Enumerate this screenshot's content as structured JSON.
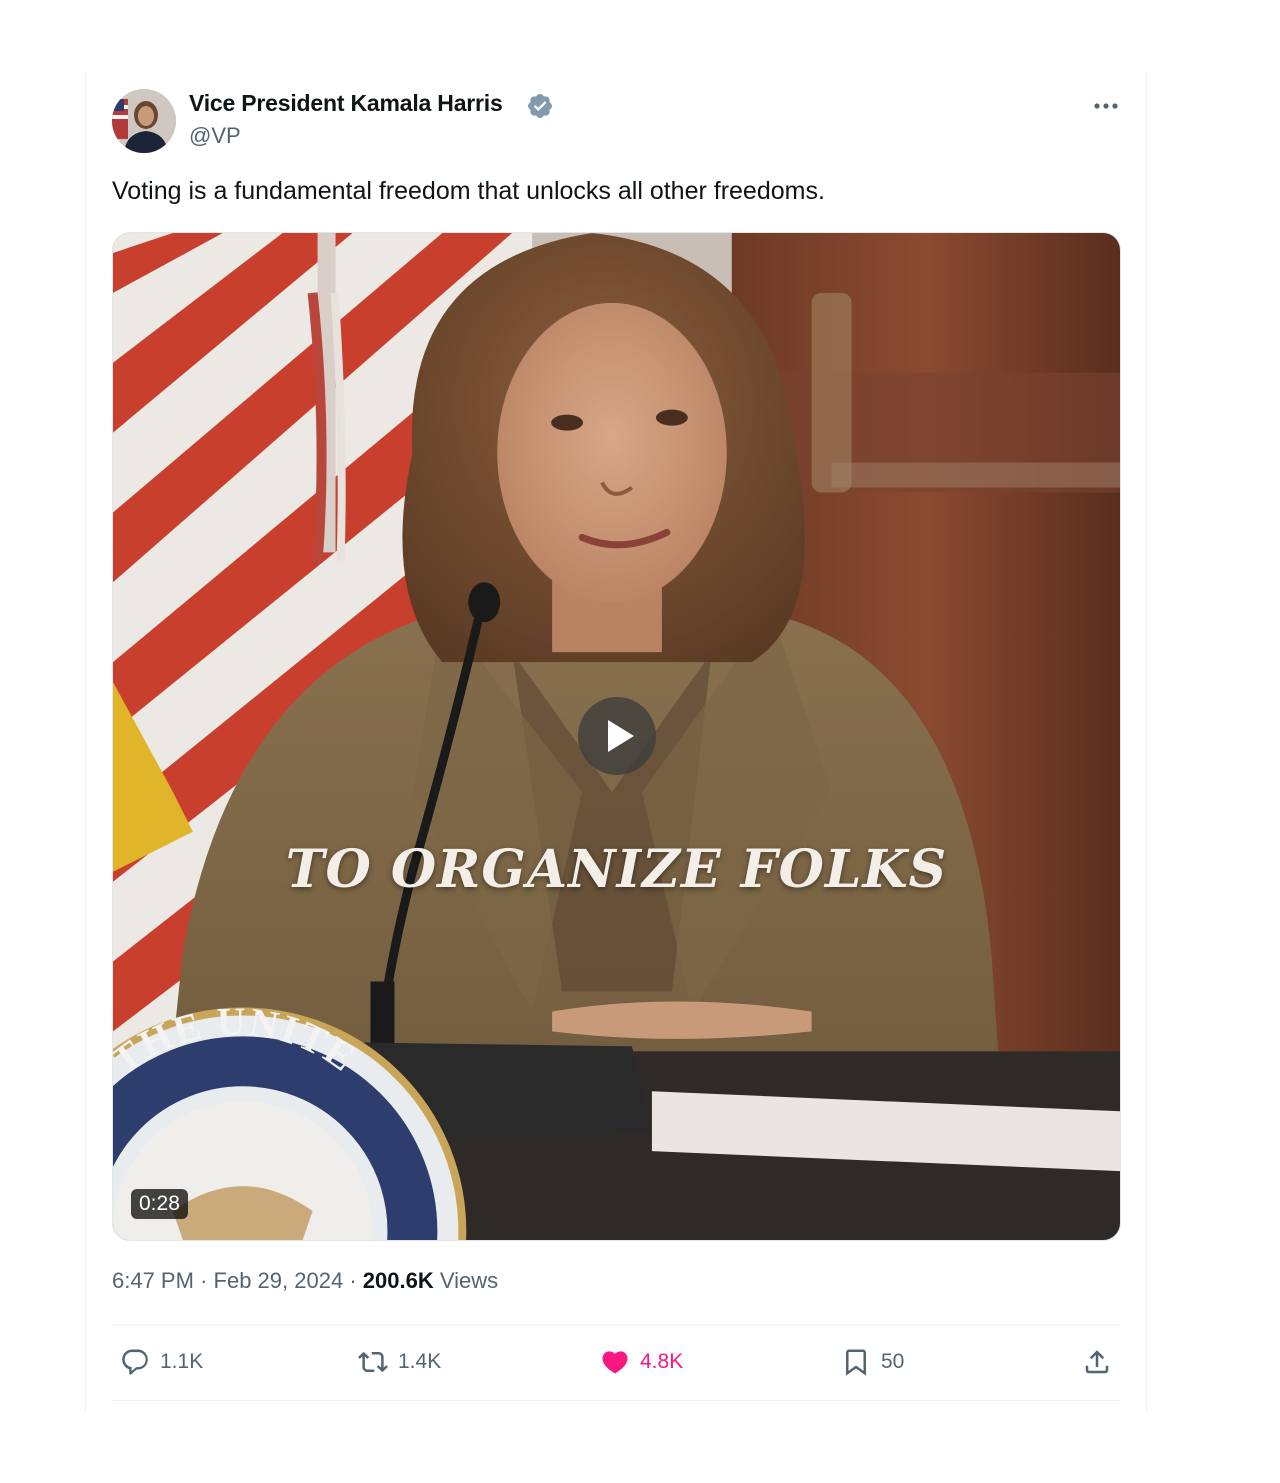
{
  "author": {
    "display_name": "Vice President Kamala Harris",
    "handle": "@VP",
    "verified": true,
    "verified_color": "#829aab"
  },
  "tweet": {
    "text": "Voting is a fundamental freedom that unlocks all other freedoms."
  },
  "media": {
    "type": "video",
    "caption": "TO ORGANIZE FOLKS",
    "duration": "0:28",
    "seal_text": "OF THE UNITE"
  },
  "meta": {
    "time": "6:47 PM",
    "separator": "·",
    "date": "Feb 29, 2024",
    "views_count": "200.6K",
    "views_label": "Views"
  },
  "actions": {
    "replies": "1.1K",
    "retweets": "1.4K",
    "likes": "4.8K",
    "bookmarks": "50",
    "liked": true,
    "like_color": "#f91880"
  },
  "icons": {
    "reply": "reply-icon",
    "retweet": "retweet-icon",
    "like": "heart-icon",
    "bookmark": "bookmark-icon",
    "share": "share-icon",
    "more": "more-icon",
    "verified": "verified-badge-icon"
  }
}
